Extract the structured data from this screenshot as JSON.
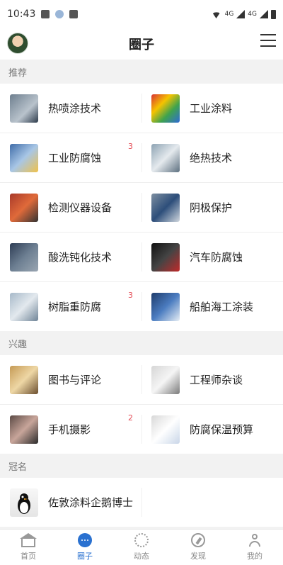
{
  "status": {
    "time": "10:43",
    "net1": "4G",
    "net2": "4G"
  },
  "header": {
    "title": "圈子"
  },
  "sections": [
    {
      "title": "推荐",
      "items": [
        {
          "label": "热喷涂技术",
          "badge": "",
          "icon": "spray-thumb"
        },
        {
          "label": "工业涂料",
          "badge": "",
          "icon": "paint-thumb"
        },
        {
          "label": "工业防腐蚀",
          "badge": "3",
          "icon": "anticorrosion-thumb"
        },
        {
          "label": "绝热技术",
          "badge": "",
          "icon": "insulation-thumb"
        },
        {
          "label": "检测仪器设备",
          "badge": "",
          "icon": "instrument-thumb"
        },
        {
          "label": "阴极保护",
          "badge": "",
          "icon": "cathodic-thumb"
        },
        {
          "label": "酸洗钝化技术",
          "badge": "",
          "icon": "pickling-thumb"
        },
        {
          "label": "汽车防腐蚀",
          "badge": "",
          "icon": "car-thumb"
        },
        {
          "label": "树脂重防腐",
          "badge": "3",
          "icon": "resin-thumb"
        },
        {
          "label": "船舶海工涂装",
          "badge": "",
          "icon": "ship-thumb"
        }
      ]
    },
    {
      "title": "兴趣",
      "items": [
        {
          "label": "图书与评论",
          "badge": "",
          "icon": "book-thumb"
        },
        {
          "label": "工程师杂谈",
          "badge": "",
          "icon": "engineer-thumb"
        },
        {
          "label": "手机摄影",
          "badge": "2",
          "icon": "photo-thumb"
        },
        {
          "label": "防腐保温预算",
          "badge": "",
          "icon": "budget-thumb"
        }
      ]
    },
    {
      "title": "冠名",
      "items": [
        {
          "label": "佐敦涂料企鹅博士",
          "badge": "",
          "icon": "penguin-thumb"
        }
      ]
    }
  ],
  "tabs": [
    {
      "label": "首页",
      "icon": "home-icon"
    },
    {
      "label": "圈子",
      "icon": "chat-bubble-icon"
    },
    {
      "label": "动态",
      "icon": "loading-dots-icon"
    },
    {
      "label": "发现",
      "icon": "compass-icon"
    },
    {
      "label": "我的",
      "icon": "user-icon"
    }
  ],
  "colors": {
    "accent": "#2a71d0",
    "badge": "#e44b55"
  }
}
